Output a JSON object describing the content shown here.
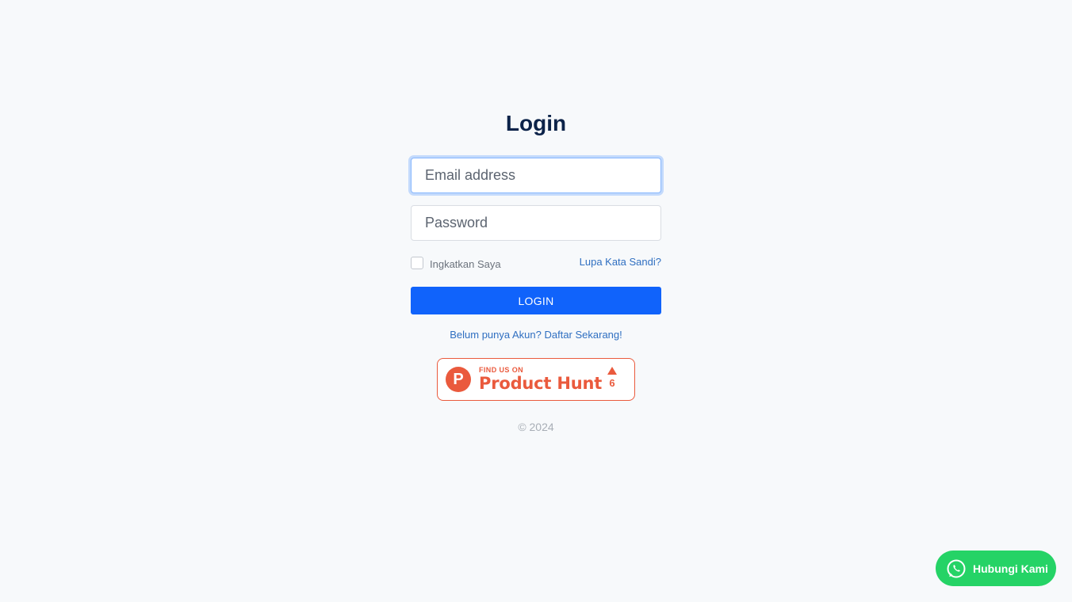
{
  "login": {
    "title": "Login",
    "email_placeholder": "Email address",
    "password_placeholder": "Password",
    "remember_label": "Ingkatkan Saya",
    "forgot_link": "Lupa Kata Sandi?",
    "submit_label": "LOGIN",
    "signup_link": "Belum punya Akun? Daftar Sekarang!"
  },
  "product_hunt": {
    "small_text": "FIND US ON",
    "big_text": "Product Hunt",
    "logo_letter": "P",
    "votes": "6",
    "color": "#ea5a3d"
  },
  "footer": {
    "copyright": "© 2024"
  },
  "whatsapp": {
    "label": "Hubungi Kami",
    "icon": "whatsapp-icon",
    "color": "#25d366"
  },
  "colors": {
    "primary": "#1063fb",
    "title": "#0c2349",
    "link": "#2f6fc1",
    "background": "#f7f9fb"
  }
}
